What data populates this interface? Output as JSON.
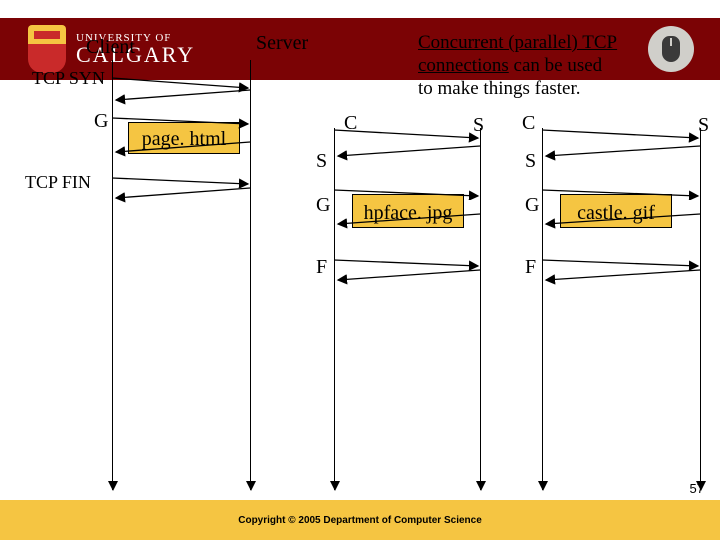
{
  "banner": {
    "uni_small": "UNIVERSITY OF",
    "uni_big": "CALGARY"
  },
  "footer": {
    "copyright": "Copyright © 2005 Department of Computer Science",
    "page_num": "57"
  },
  "roles": {
    "client": "Client",
    "server": "Server"
  },
  "events": {
    "syn": "TCP SYN",
    "fin": "TCP FIN",
    "C": "C",
    "S": "S",
    "G": "G",
    "F": "F"
  },
  "resources": {
    "page": "page. html",
    "hpface": "hpface. jpg",
    "castle": "castle. gif"
  },
  "description": {
    "line1a": "Concurrent (parallel) TCP",
    "line1b": "connections",
    "line2": " can be used",
    "line3": "to make things faster."
  }
}
